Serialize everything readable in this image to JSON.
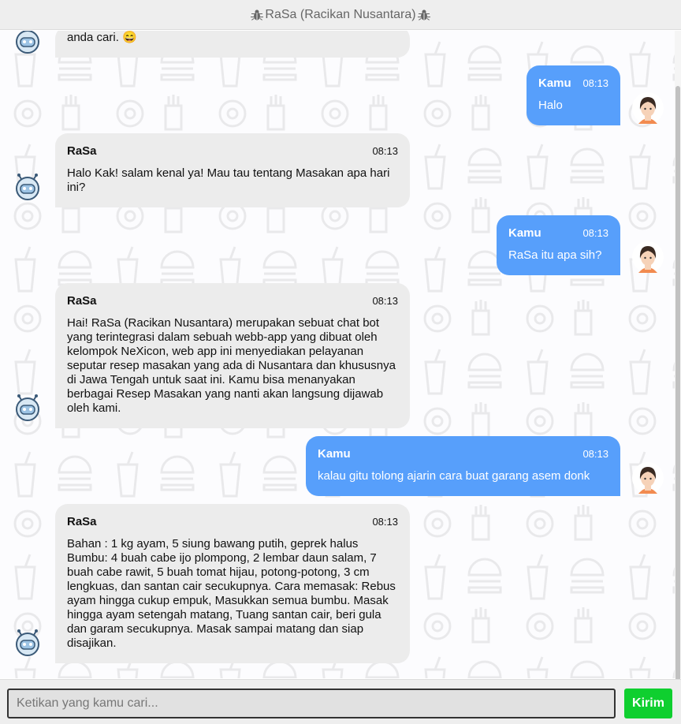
{
  "header": {
    "title": "RaSa (Racikan Nusantara)",
    "left_icon": "bug-icon",
    "right_icon": "bug-icon"
  },
  "colors": {
    "user_bubble": "#579ffb",
    "bot_bubble": "#ececec",
    "send_button": "#0fcf2f"
  },
  "messages": [
    {
      "sender": "RaSa",
      "time": "",
      "text": "anda cari. 😄"
    },
    {
      "sender": "Kamu",
      "time": "08:13",
      "text": "Halo"
    },
    {
      "sender": "RaSa",
      "time": "08:13",
      "text": "Halo Kak! salam kenal ya! Mau tau tentang Masakan apa hari ini?"
    },
    {
      "sender": "Kamu",
      "time": "08:13",
      "text": "RaSa itu apa sih?"
    },
    {
      "sender": "RaSa",
      "time": "08:13",
      "text": "Hai! RaSa (Racikan Nusantara) merupakan sebuat chat bot yang terintegrasi dalam sebuah webb-app yang dibuat oleh kelompok NeXicon, web app ini menyediakan pelayanan seputar resep masakan yang ada di Nusantara dan khususnya di Jawa Tengah untuk saat ini. Kamu bisa menanyakan berbagai Resep Masakan yang nanti akan langsung dijawab oleh kami."
    },
    {
      "sender": "Kamu",
      "time": "08:13",
      "text": "kalau gitu tolong ajarin cara buat garang asem donk"
    },
    {
      "sender": "RaSa",
      "time": "08:13",
      "text": "Bahan : 1 kg ayam, 5 siung bawang putih, geprek halus Bumbu: 4 buah cabe ijo plompong, 2 lembar daun salam, 7 buah cabe rawit, 5 buah tomat hijau, potong-potong, 3 cm lengkuas, dan santan cair secukupnya. Cara memasak: Rebus ayam hingga cukup empuk, Masukkan semua bumbu. Masak hingga ayam setengah matang, Tuang santan cair, beri gula dan garam secukupnya. Masak sampai matang dan siap disajikan."
    }
  ],
  "input": {
    "placeholder": "Ketikan yang kamu cari...",
    "value": ""
  },
  "send_label": "Kirim"
}
